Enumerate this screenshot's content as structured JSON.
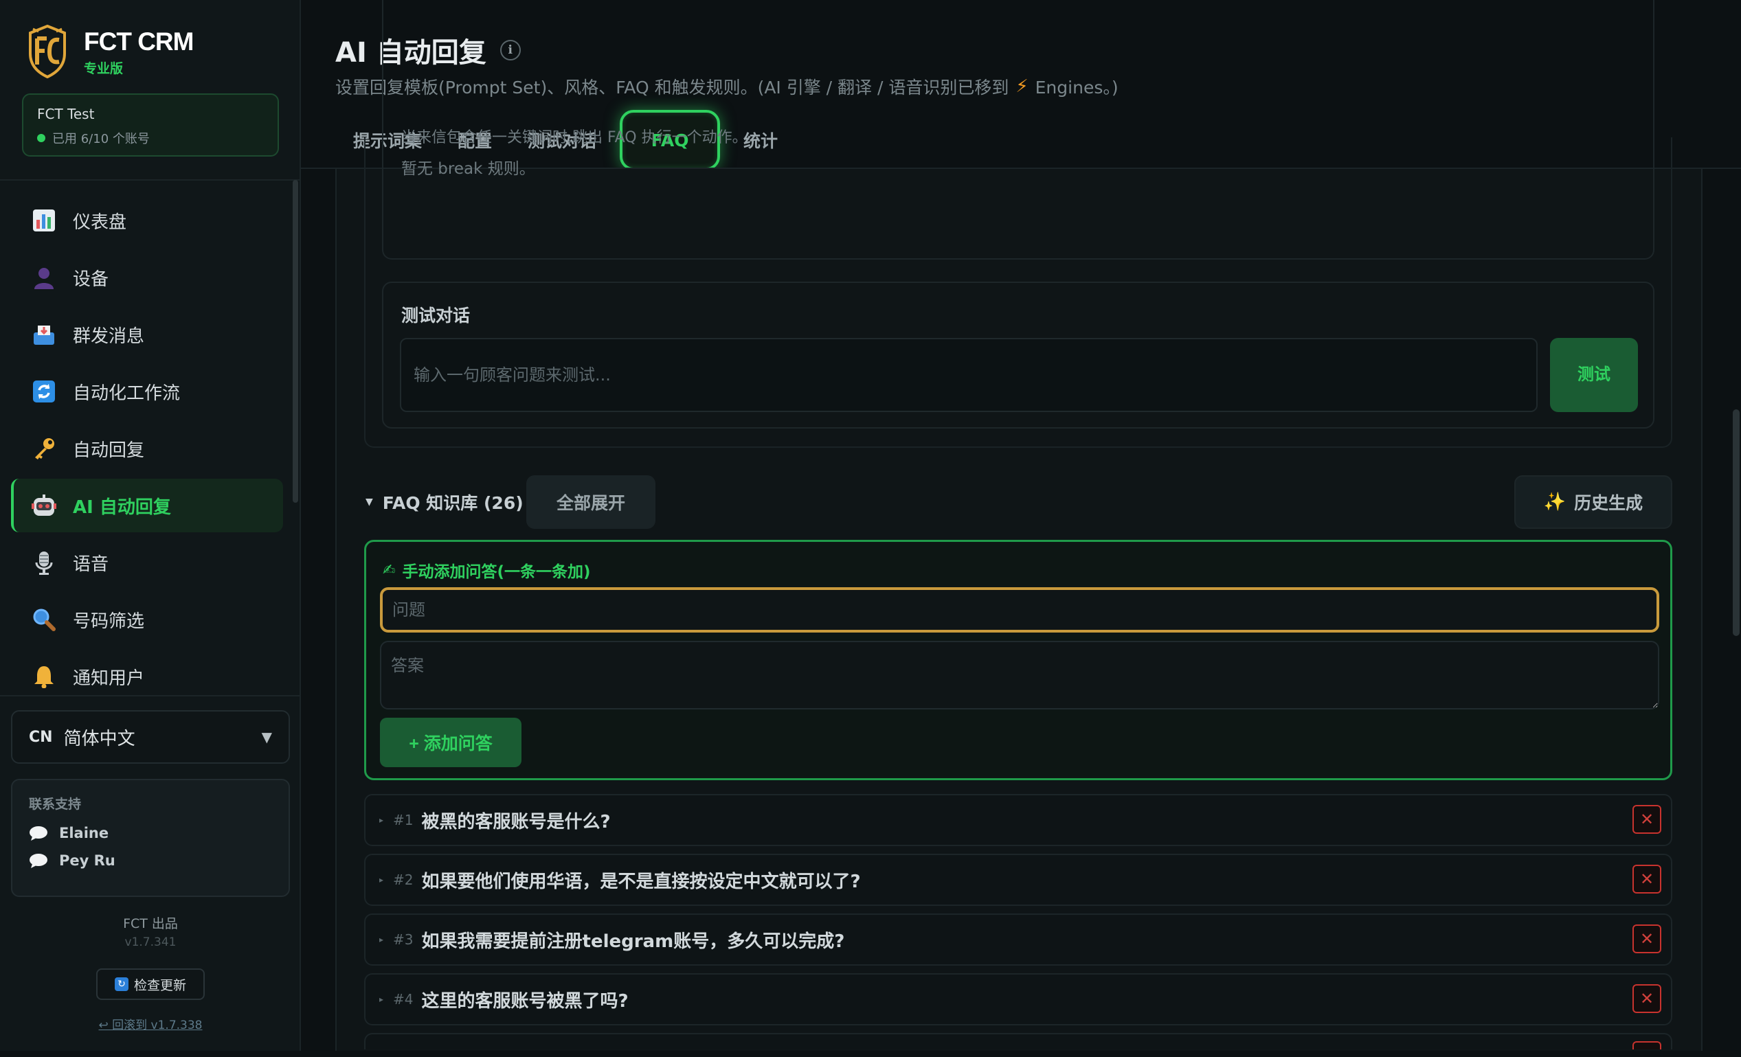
{
  "app": {
    "name": "FCT CRM",
    "edition": "专业版",
    "account_name": "FCT Test",
    "account_usage": "已用 6/10 个账号"
  },
  "nav": {
    "items": [
      {
        "label": "仪表盘",
        "icon": "bar-chart-icon"
      },
      {
        "label": "设备",
        "icon": "user-silhouette-icon"
      },
      {
        "label": "群发消息",
        "icon": "inbox-tray-icon"
      },
      {
        "label": "自动化工作流",
        "icon": "refresh-icon"
      },
      {
        "label": "自动回复",
        "icon": "key-icon"
      },
      {
        "label": "AI 自动回复",
        "icon": "robot-icon"
      },
      {
        "label": "语音",
        "icon": "microphone-icon"
      },
      {
        "label": "号码筛选",
        "icon": "magnifier-icon"
      },
      {
        "label": "通知用户",
        "icon": "bell-icon"
      }
    ],
    "active_index": 5
  },
  "language": {
    "code": "CN",
    "label": "简体中文"
  },
  "support": {
    "title": "联系支持",
    "contacts": [
      "Elaine",
      "Pey Ru"
    ]
  },
  "footer": {
    "maker": "FCT 出品",
    "version": "v1.7.341",
    "update_label": "检查更新",
    "rollback_label": "↩ 回滚到 v1.7.338"
  },
  "page": {
    "title": "AI 自动回复",
    "subtitle_pre": "设置回复模板(Prompt Set)、风格、FAQ 和触发规则。(AI 引擎 / 翻译 / 语音识别已移到",
    "subtitle_post": "Engines。)"
  },
  "tabs": [
    {
      "label": "提示词集"
    },
    {
      "label": "配置"
    },
    {
      "label": "测试对话"
    },
    {
      "label": "FAQ"
    },
    {
      "label": "统计"
    }
  ],
  "active_tab": "FAQ",
  "break_rules": {
    "description": "当来信包含任一关键词时,跳出 FAQ 执行一个动作。",
    "empty": "暂无 break 规则。"
  },
  "test_chat": {
    "title": "测试对话",
    "placeholder": "输入一句顾客问题来测试...",
    "button_label": "测试"
  },
  "faq": {
    "header_label": "FAQ 知识库 (26)",
    "expand_all_label": "全部展开",
    "history_label": "历史生成",
    "manual_add": {
      "title": "手动添加问答(一条一条加)",
      "question_placeholder": "问题",
      "answer_placeholder": "答案",
      "add_button_label": "+ 添加问答"
    },
    "items": [
      {
        "num": "#1",
        "question": "被黑的客服账号是什么?"
      },
      {
        "num": "#2",
        "question": "如果要他们使用华语，是不是直接按设定中文就可以了?"
      },
      {
        "num": "#3",
        "question": "如果我需要提前注册telegram账号，多久可以完成?"
      },
      {
        "num": "#4",
        "question": "这里的客服账号被黑了吗?"
      }
    ]
  },
  "colors": {
    "accent": "#2fd15f",
    "danger": "#c8332e",
    "focus_outline": "#c99a3c",
    "background": "#0c1113"
  }
}
